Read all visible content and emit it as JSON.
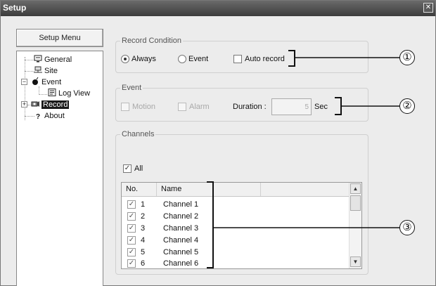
{
  "window": {
    "title": "Setup",
    "close_glyph": "✕"
  },
  "menu": {
    "title": "Setup Menu"
  },
  "tree": {
    "items": [
      {
        "label": "General",
        "icon": "monitor-icon"
      },
      {
        "label": "Site",
        "icon": "network-icon"
      },
      {
        "label": "Event",
        "icon": "bomb-icon"
      },
      {
        "label": "Log View",
        "icon": "log-icon"
      },
      {
        "label": "Record",
        "icon": "camera-icon",
        "selected": true
      },
      {
        "label": "About",
        "icon": "question-icon"
      }
    ],
    "expand_minus": "−",
    "expand_plus": "+"
  },
  "record_condition": {
    "legend": "Record Condition",
    "always_label": "Always",
    "event_label": "Event",
    "auto_record_label": "Auto record",
    "selected": "Always",
    "auto_record_checked": false
  },
  "event": {
    "legend": "Event",
    "motion_label": "Motion",
    "alarm_label": "Alarm",
    "duration_label": "Duration :",
    "duration_value": "5",
    "duration_unit": "Sec"
  },
  "channels": {
    "legend": "Channels",
    "all_label": "All",
    "all_checked": true,
    "columns": [
      "No.",
      "Name"
    ],
    "rows": [
      {
        "no": "1",
        "name": "Channel 1",
        "checked": true
      },
      {
        "no": "2",
        "name": "Channel 2",
        "checked": true
      },
      {
        "no": "3",
        "name": "Channel 3",
        "checked": true
      },
      {
        "no": "4",
        "name": "Channel 4",
        "checked": true
      },
      {
        "no": "5",
        "name": "Channel 5",
        "checked": true
      },
      {
        "no": "6",
        "name": "Channel 6",
        "checked": true
      }
    ],
    "scroll_up": "▲",
    "scroll_down": "▼"
  },
  "callouts": [
    "①",
    "②",
    "③"
  ],
  "check_glyph": "✓"
}
